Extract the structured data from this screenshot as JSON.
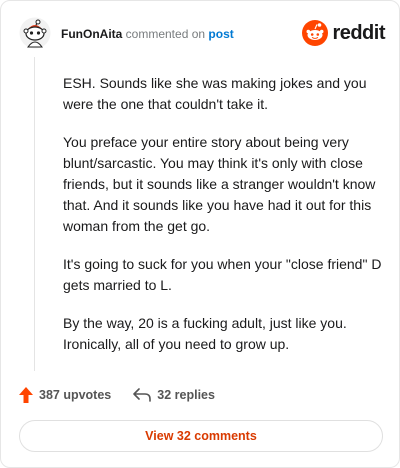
{
  "header": {
    "username": "FunOnAita",
    "verb": "commented on",
    "link_label": "post",
    "brand_name": "reddit",
    "brand_color": "#ff4500"
  },
  "comment": {
    "paragraphs": [
      "ESH. Sounds like she was making jokes and you were the one that couldn't take it.",
      "You preface your entire story about being very blunt/sarcastic. You may think it's only with close friends, but it sounds like a stranger wouldn't know that. And it sounds like you have had it out for this woman from the get go.",
      "It's going to suck for you when your \"close friend\" D gets married to L.",
      "By the way, 20 is a fucking adult, just like you. Ironically, all of you need to grow up."
    ]
  },
  "footer": {
    "upvotes_label": "387 upvotes",
    "replies_label": "32 replies",
    "upvote_icon": "upvote-arrow-icon",
    "reply_icon": "reply-arrow-icon"
  },
  "view_button": {
    "label": "View 32 comments"
  },
  "colors": {
    "accent": "#d93a00",
    "link": "#0079d3"
  }
}
